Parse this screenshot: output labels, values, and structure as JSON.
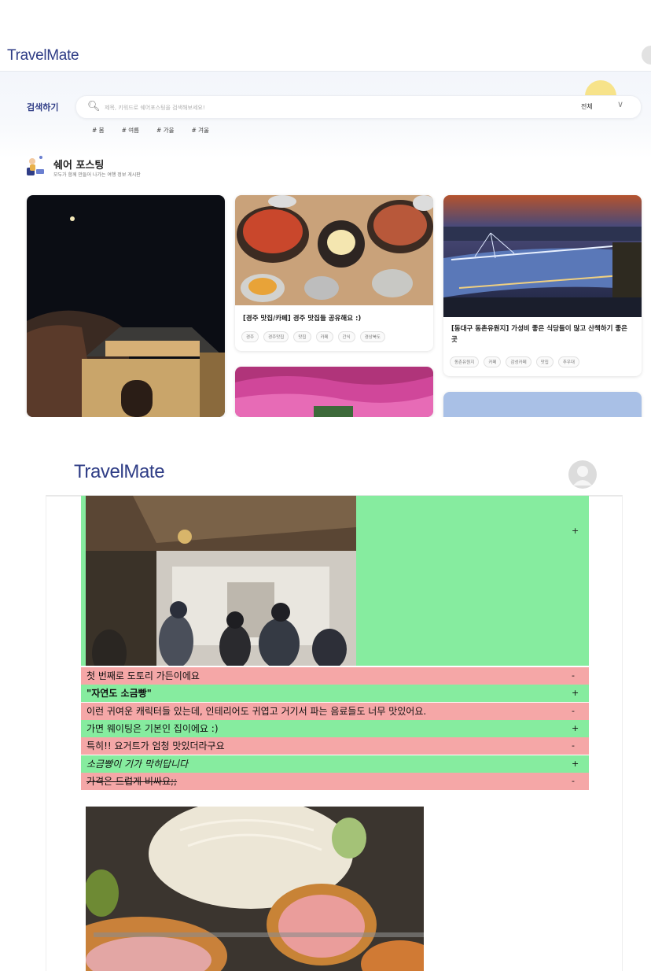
{
  "screen1": {
    "brand": "TravelMate",
    "search": {
      "label": "검색하기",
      "placeholder": "제목, 키워드로 쉐어포스팅을 검색해보세요!",
      "select_value": "전체"
    },
    "tags": [
      "# 봄",
      "# 여름",
      "# 가을",
      "# 겨울"
    ],
    "section": {
      "title": "쉐어 포스팅",
      "subtitle": "모두가 함께 만들어 나가는 여행 정보 게시판"
    },
    "cards": [
      {
        "title": "[경주 맛집/카페] 경주 맛집들 공유해요 :)",
        "chips": [
          "경주",
          "경주맛집",
          "맛집",
          "카페",
          "간식",
          "경상북도"
        ]
      },
      {
        "title": "[동대구 동촌유원지] 가성비 좋은 식당들이 많고 산책하기 좋은 곳",
        "chips": [
          "동촌유원지",
          "카페",
          "감성카페",
          "맛집",
          "추우대"
        ]
      }
    ]
  },
  "screen2": {
    "brand": "TravelMate",
    "diff_lines": [
      {
        "text": "첫 번째로 도토리 가든이에요",
        "sign": "-",
        "type": "del",
        "style": ""
      },
      {
        "text": "\"자연도 소금빵\"",
        "sign": "+",
        "type": "add",
        "style": "bold"
      },
      {
        "text": "이런 귀여운 캐릭터들 있는데, 인테리어도 귀엽고 거기서 파는 음료들도 너무 맛있어요.",
        "sign": "-",
        "type": "del",
        "style": ""
      },
      {
        "text": "가면 웨이팅은 기본인 집이에요 :)",
        "sign": "+",
        "type": "add",
        "style": ""
      },
      {
        "text": "특히!! 요거트가 엄청 맛있더라구요",
        "sign": "-",
        "type": "del",
        "style": ""
      },
      {
        "text": "소금빵이 기가 막히답니다",
        "sign": "+",
        "type": "add",
        "style": "italic"
      },
      {
        "text": "가격은 드럽게 비싸요;;",
        "sign": "-",
        "type": "del",
        "style": "strike"
      }
    ],
    "image_block_sign": "+"
  },
  "colors": {
    "brand": "#2f3d86",
    "diff_add": "#86ec9f",
    "diff_del": "#f5a7a7"
  }
}
